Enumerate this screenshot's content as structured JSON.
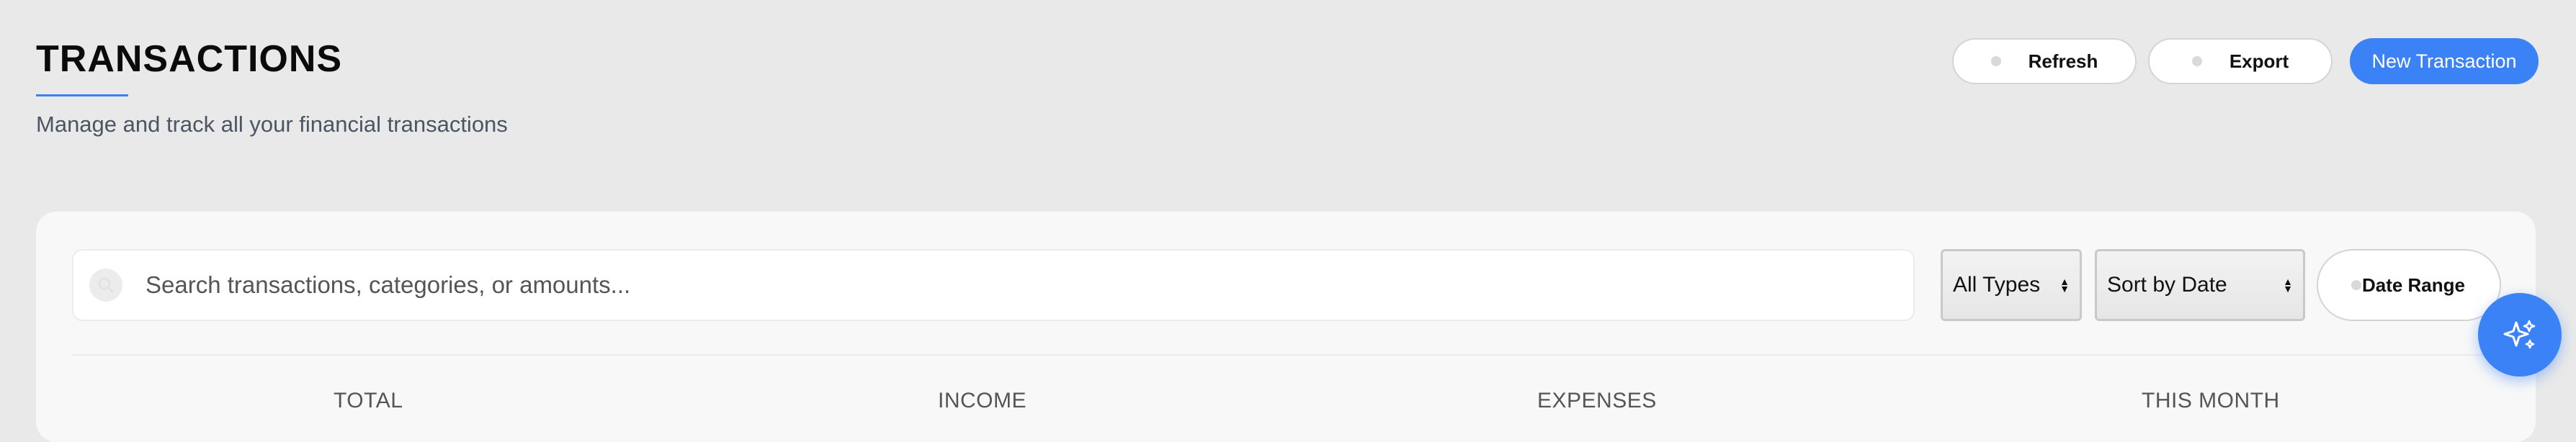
{
  "header": {
    "title": "TRANSACTIONS",
    "subtitle": "Manage and track all your financial transactions"
  },
  "actions": {
    "refresh_label": "Refresh",
    "export_label": "Export",
    "new_transaction_label": "New Transaction"
  },
  "filters": {
    "search_placeholder": "Search transactions, categories, or amounts...",
    "type_selected": "All Types",
    "sort_selected": "Sort by Date",
    "date_range_label": "Date Range"
  },
  "stats": {
    "labels": [
      "TOTAL",
      "INCOME",
      "EXPENSES",
      "THIS MONTH"
    ]
  },
  "colors": {
    "accent": "#3b82f6",
    "background": "#e9e9e9",
    "panel": "#f8f8f8"
  },
  "icons": {
    "search": "search-icon",
    "refresh": "refresh-icon",
    "export": "export-icon",
    "date_range": "calendar-icon",
    "fab": "sparkles-icon"
  }
}
